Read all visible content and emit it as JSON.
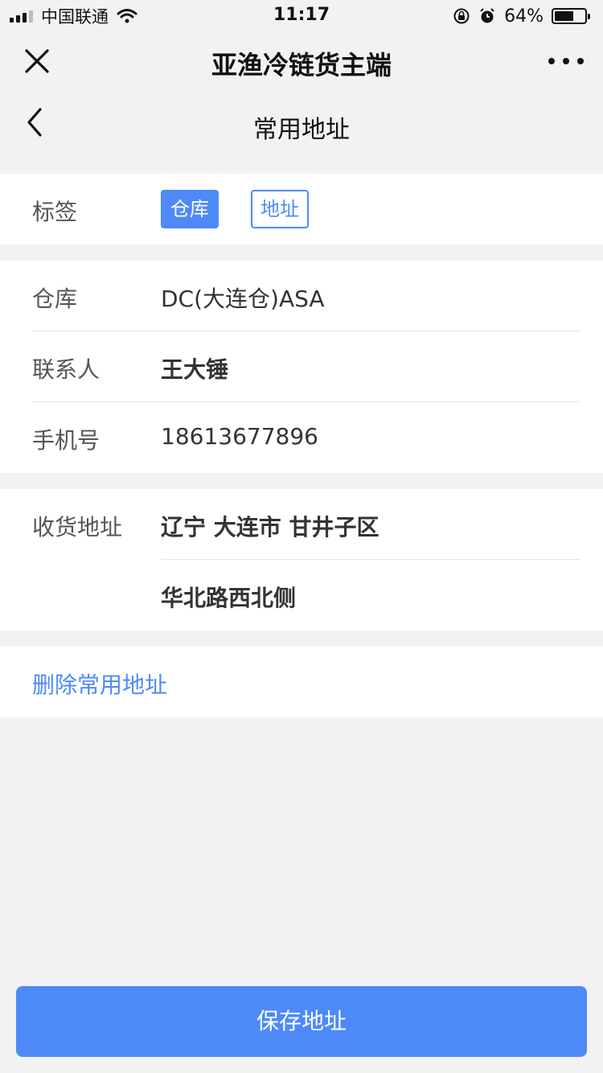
{
  "status_bar": {
    "carrier": "中国联通",
    "time": "11:17",
    "battery_text": "64%",
    "battery_level": 0.64
  },
  "app": {
    "title": "亚渔冷链货主端"
  },
  "nav": {
    "title": "常用地址"
  },
  "tags": {
    "label": "标签",
    "options": [
      "仓库",
      "地址"
    ],
    "selected": "仓库"
  },
  "info": {
    "warehouse_label": "仓库",
    "warehouse_value": "DC(大连仓)ASA",
    "contact_label": "联系人",
    "contact_value": "王大锤",
    "phone_label": "手机号",
    "phone_value": "18613677896"
  },
  "address": {
    "label": "收货地址",
    "region": "辽宁 大连市 甘井子区",
    "detail": "华北路西北侧"
  },
  "actions": {
    "delete_label": "删除常用地址",
    "save_label": "保存地址"
  },
  "colors": {
    "accent": "#4d8af7",
    "background": "#f2f2f2"
  }
}
